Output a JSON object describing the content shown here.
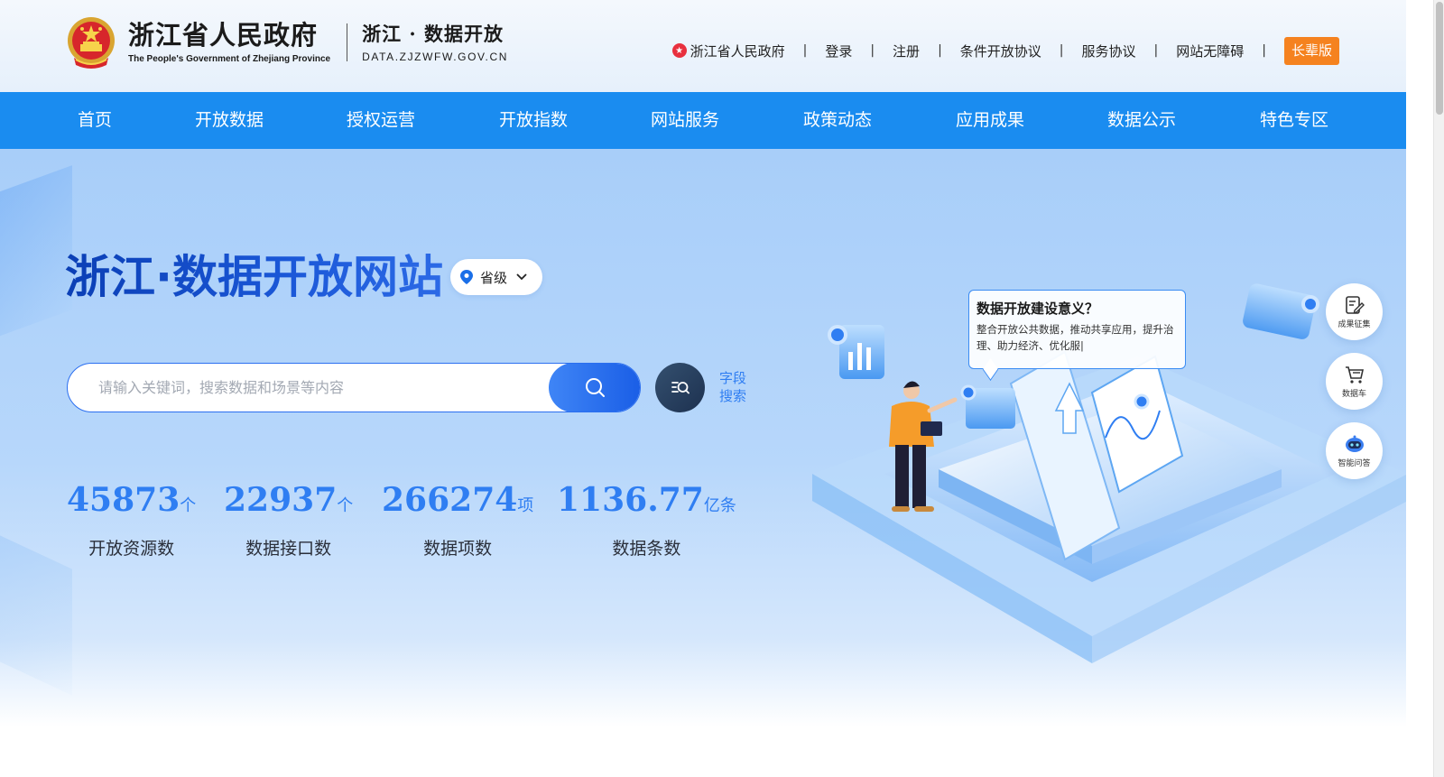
{
  "header": {
    "gov_title": "浙江省人民政府",
    "gov_subtitle": "The People's Government of Zhejiang Province",
    "site_title": "浙江 · 数据开放",
    "site_domain": "DATA.ZJZWFW.GOV.CN",
    "links": [
      {
        "label": "浙江省人民政府"
      },
      {
        "label": "登录"
      },
      {
        "label": "注册"
      },
      {
        "label": "条件开放协议"
      },
      {
        "label": "服务协议"
      },
      {
        "label": "网站无障碍"
      }
    ],
    "separator": "|",
    "elder_mode": "长辈版"
  },
  "nav": {
    "items": [
      {
        "label": "首页"
      },
      {
        "label": "开放数据"
      },
      {
        "label": "授权运营"
      },
      {
        "label": "开放指数"
      },
      {
        "label": "网站服务"
      },
      {
        "label": "政策动态"
      },
      {
        "label": "应用成果"
      },
      {
        "label": "数据公示"
      },
      {
        "label": "特色专区"
      }
    ]
  },
  "hero": {
    "title": "浙江·数据开放网站",
    "level_select": "省级",
    "search_placeholder": "请输入关键词，搜索数据和场景等内容",
    "field_search_line1": "字段",
    "field_search_line2": "搜索"
  },
  "stats": [
    {
      "value": "45873",
      "unit": "个",
      "label": "开放资源数"
    },
    {
      "value": "22937",
      "unit": "个",
      "label": "数据接口数"
    },
    {
      "value": "266274",
      "unit": "项",
      "label": "数据项数"
    },
    {
      "value": "1136.77",
      "unit": "亿条",
      "label": "数据条数"
    }
  ],
  "bubble": {
    "title": "数据开放建设意义？",
    "text": "整合开放公共数据，推动共享应用，提升治理、助力经济、优化服|"
  },
  "side_buttons": [
    {
      "label": "成果征集"
    },
    {
      "label": "数据车"
    },
    {
      "label": "智能问答"
    }
  ],
  "colors": {
    "nav_bg": "#1a8cf0",
    "accent_blue": "#2f7ef2",
    "elder_orange": "#f5821f"
  }
}
